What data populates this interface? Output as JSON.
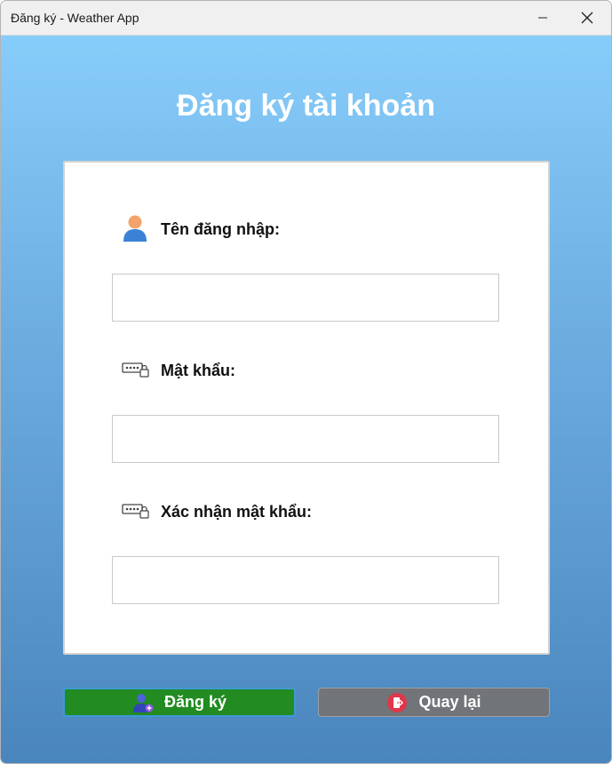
{
  "window": {
    "title": "Đăng ký - Weather App"
  },
  "form": {
    "heading": "Đăng ký tài khoản",
    "fields": [
      {
        "label": "Tên đăng nhập:",
        "icon": "user-icon",
        "value": ""
      },
      {
        "label": "Mật khẩu:",
        "icon": "password-icon",
        "value": ""
      },
      {
        "label": "Xác nhận mật khẩu:",
        "icon": "password-icon",
        "value": ""
      }
    ]
  },
  "buttons": {
    "register_label": "Đăng ký",
    "back_label": "Quay lại"
  },
  "colors": {
    "gradient_top": "#87cdfa",
    "gradient_bottom": "#4a86bd",
    "register_button": "#228b22",
    "back_button": "#717479"
  }
}
